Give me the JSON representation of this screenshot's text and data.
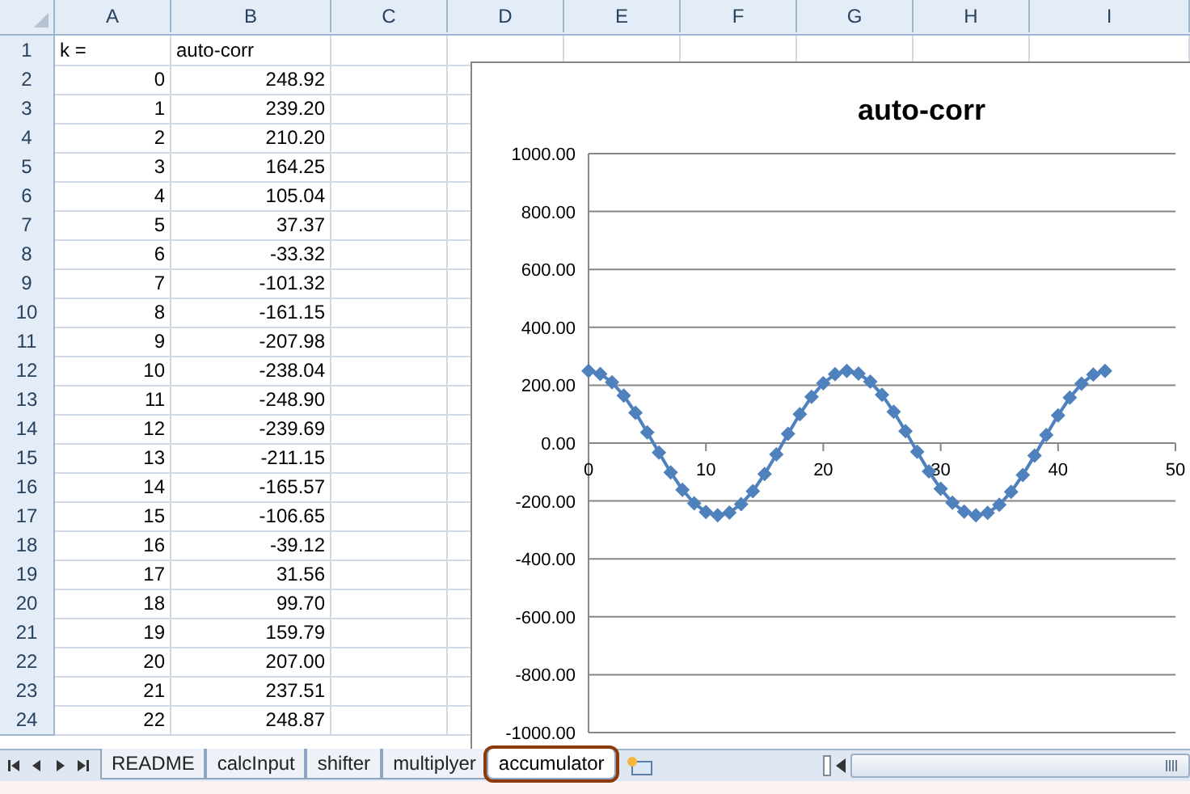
{
  "sheet": {
    "columns": [
      "A",
      "B",
      "C",
      "D",
      "E",
      "F",
      "G",
      "H",
      "I"
    ],
    "rows": [
      {
        "number": "1",
        "kind": "label",
        "cells": [
          "k =",
          "auto-corr"
        ]
      },
      {
        "number": "2",
        "kind": "number",
        "cells": [
          "0",
          "248.92"
        ]
      },
      {
        "number": "3",
        "kind": "number",
        "cells": [
          "1",
          "239.20"
        ]
      },
      {
        "number": "4",
        "kind": "number",
        "cells": [
          "2",
          "210.20"
        ]
      },
      {
        "number": "5",
        "kind": "number",
        "cells": [
          "3",
          "164.25"
        ]
      },
      {
        "number": "6",
        "kind": "number",
        "cells": [
          "4",
          "105.04"
        ]
      },
      {
        "number": "7",
        "kind": "number",
        "cells": [
          "5",
          "37.37"
        ]
      },
      {
        "number": "8",
        "kind": "number",
        "cells": [
          "6",
          "-33.32"
        ]
      },
      {
        "number": "9",
        "kind": "number",
        "cells": [
          "7",
          "-101.32"
        ]
      },
      {
        "number": "10",
        "kind": "number",
        "cells": [
          "8",
          "-161.15"
        ]
      },
      {
        "number": "11",
        "kind": "number",
        "cells": [
          "9",
          "-207.98"
        ]
      },
      {
        "number": "12",
        "kind": "number",
        "cells": [
          "10",
          "-238.04"
        ]
      },
      {
        "number": "13",
        "kind": "number",
        "cells": [
          "11",
          "-248.90"
        ]
      },
      {
        "number": "14",
        "kind": "number",
        "cells": [
          "12",
          "-239.69"
        ]
      },
      {
        "number": "15",
        "kind": "number",
        "cells": [
          "13",
          "-211.15"
        ]
      },
      {
        "number": "16",
        "kind": "number",
        "cells": [
          "14",
          "-165.57"
        ]
      },
      {
        "number": "17",
        "kind": "number",
        "cells": [
          "15",
          "-106.65"
        ]
      },
      {
        "number": "18",
        "kind": "number",
        "cells": [
          "16",
          "-39.12"
        ]
      },
      {
        "number": "19",
        "kind": "number",
        "cells": [
          "17",
          "31.56"
        ]
      },
      {
        "number": "20",
        "kind": "number",
        "cells": [
          "18",
          "99.70"
        ]
      },
      {
        "number": "21",
        "kind": "number",
        "cells": [
          "19",
          "159.79"
        ]
      },
      {
        "number": "22",
        "kind": "number",
        "cells": [
          "20",
          "207.00"
        ]
      },
      {
        "number": "23",
        "kind": "number",
        "cells": [
          "21",
          "237.51"
        ]
      },
      {
        "number": "24",
        "kind": "number",
        "cells": [
          "22",
          "248.87"
        ]
      }
    ]
  },
  "chart": {
    "chart_data": {
      "type": "line",
      "title": "auto-corr",
      "x": [
        0,
        1,
        2,
        3,
        4,
        5,
        6,
        7,
        8,
        9,
        10,
        11,
        12,
        13,
        14,
        15,
        16,
        17,
        18,
        19,
        20,
        21,
        22,
        23,
        24,
        25,
        26,
        27,
        28,
        29,
        30,
        31,
        32,
        33,
        34,
        35,
        36,
        37,
        38,
        39,
        40,
        41,
        42,
        43,
        44
      ],
      "grid": true,
      "series": [
        {
          "color": "#4f81bd",
          "marker": "diamond",
          "values": [
            249,
            239,
            210,
            164,
            105,
            37,
            -33,
            -101,
            -161,
            -208,
            -238,
            -249,
            -240,
            -211,
            -166,
            -107,
            -39,
            32,
            100,
            160,
            207,
            238,
            249,
            240,
            212,
            167,
            108,
            41,
            -30,
            -98,
            -158,
            -206,
            -237,
            -249,
            -241,
            -213,
            -168,
            -110,
            -43,
            28,
            96,
            157,
            205,
            237,
            249
          ]
        }
      ],
      "xlim": [
        0,
        50
      ],
      "ylim": [
        -1000,
        1000
      ],
      "xticks": [
        0,
        10,
        20,
        30,
        40,
        50
      ],
      "yticks": [
        {
          "value": 1000,
          "label": "1000.00"
        },
        {
          "value": 800,
          "label": "800.00"
        },
        {
          "value": 600,
          "label": "600.00"
        },
        {
          "value": 400,
          "label": "400.00"
        },
        {
          "value": 200,
          "label": "200.00"
        },
        {
          "value": 0,
          "label": "0.00"
        },
        {
          "value": -200,
          "label": "-200.00"
        },
        {
          "value": -400,
          "label": "-400.00"
        },
        {
          "value": -600,
          "label": "-600.00"
        },
        {
          "value": -800,
          "label": "-800.00"
        },
        {
          "value": -1000,
          "label": "-1000.00"
        }
      ]
    }
  },
  "sheet_tabs": [
    {
      "label": "README",
      "selected": false,
      "highlighted": false
    },
    {
      "label": "calcInput",
      "selected": false,
      "highlighted": false
    },
    {
      "label": "shifter",
      "selected": false,
      "highlighted": false
    },
    {
      "label": "multiplyer",
      "selected": false,
      "highlighted": false
    },
    {
      "label": "accumulator",
      "selected": true,
      "highlighted": true
    }
  ]
}
